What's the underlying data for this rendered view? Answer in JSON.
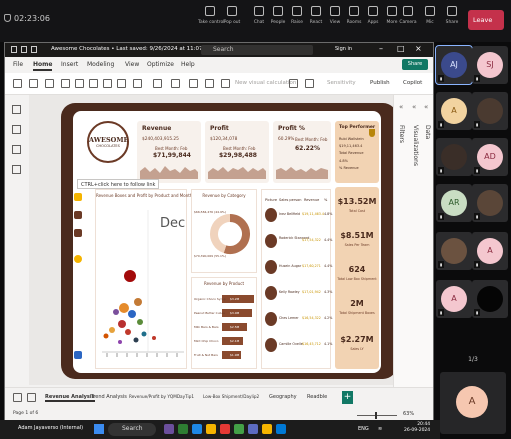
{
  "meeting": {
    "time": "02:23:06",
    "controls": [
      {
        "label": "Take control",
        "icon": "take-control-icon"
      },
      {
        "label": "Pop out",
        "icon": "pop-out-icon"
      },
      {
        "label": "Chat",
        "icon": "chat-icon"
      },
      {
        "label": "People",
        "icon": "people-icon"
      },
      {
        "label": "Raise",
        "icon": "raise-hand-icon"
      },
      {
        "label": "React",
        "icon": "react-icon"
      },
      {
        "label": "View",
        "icon": "view-icon"
      },
      {
        "label": "Rooms",
        "icon": "rooms-icon"
      },
      {
        "label": "Apps",
        "icon": "apps-icon"
      },
      {
        "label": "More",
        "icon": "more-icon"
      },
      {
        "label": "Camera",
        "icon": "camera-icon"
      },
      {
        "label": "Mic",
        "icon": "mic-icon"
      },
      {
        "label": "Share",
        "icon": "share-icon"
      }
    ],
    "people_count": "30",
    "leave_label": "Leave"
  },
  "pbi": {
    "title": "Awesome Chocolates • Last saved: 9/26/2024 at 11:07 PM",
    "search_placeholder": "Search",
    "signin": "Sign in",
    "menu_tabs": [
      "File",
      "Home",
      "Insert",
      "Modeling",
      "View",
      "Optimize",
      "Help"
    ],
    "active_tab": "Home",
    "share_label": "Share",
    "toolbar": {
      "new_visual_calc": "New visual calculation",
      "sensitivity": "Sensitivity",
      "publish": "Publish",
      "copilot": "Copilot"
    },
    "right_panes": [
      "Visualizations",
      "Filters",
      "Data"
    ],
    "page_tabs": [
      "Revenue Analysis",
      "Trend Analysis",
      "Revenue/Profit by YQMDayTip1",
      "Low-Box Shipment/Daylip2",
      "Geography",
      "Readble"
    ],
    "active_page": "Revenue Analysis",
    "status_page": "Page 1 of 6",
    "zoom": "63%"
  },
  "report": {
    "logo_line1": "AWESOME",
    "logo_line2": "CHOCOLATES",
    "tooltip": "CTRL+click here to follow link",
    "kpis": [
      {
        "title": "Revenue",
        "value": "$240,403,915.25",
        "metric_title": "Best Month: Feb",
        "metric_value": "$71,99,844"
      },
      {
        "title": "Profit",
        "value": "$120,34,078",
        "metric_title": "Best Month: Feb",
        "metric_value": "$29,98,488"
      },
      {
        "title": "Profit %",
        "value": "60.29%",
        "metric_title": "Best Month: Feb",
        "metric_value": "62.22%"
      }
    ],
    "top_performer": {
      "title": "Top Performer",
      "lines": [
        "Rubi Wallstein",
        "$19,11,463.4",
        "Total Revenue",
        "4.8%",
        "% Revenue"
      ]
    },
    "panel_titles": {
      "scatter": "Revenue Boxes and Profit by Product and Month",
      "donut": "Revenue by Category",
      "bars": "Revenue by Product"
    },
    "month_label": "Dec",
    "donut": {
      "outer_label": "$66,584,476 (44.9%)",
      "inner_label": "$70,390,069 (55.1%)",
      "segments": [
        {
          "value": 55.1,
          "color": "#b07050"
        },
        {
          "value": 44.9,
          "color": "#f0d3bd"
        }
      ]
    },
    "bars": [
      {
        "name": "Organic Choco Syrup",
        "value": 3.2
      },
      {
        "name": "Peanut Butter Cubes",
        "value": 3.0
      },
      {
        "name": "Milk Bars & Bars",
        "value": 2.5
      },
      {
        "name": "Mint Chip Choco",
        "value": 2.1
      },
      {
        "name": "Fruit & Nut Bars",
        "value": 1.9
      }
    ],
    "bar_labels": [
      "$3.2M",
      "$3.0M",
      "$2.5M",
      "$2.1M",
      "$1.9M"
    ],
    "table_headers": [
      "Picture",
      "Sales person",
      "Revenue",
      "%"
    ],
    "table_rows": [
      {
        "name": "Inez Bellfield",
        "revenue": "$19,11,463.4",
        "pct": "4.8%"
      },
      {
        "name": "Roderick Stannard",
        "revenue": "$17,54,322",
        "pct": "4.4%"
      },
      {
        "name": "Husein Augar",
        "revenue": "$17,60,271",
        "pct": "4.4%"
      },
      {
        "name": "Kelly Rowley",
        "revenue": "$17,01,942",
        "pct": "4.3%"
      },
      {
        "name": "Ches Lemer",
        "revenue": "$16,54,322",
        "pct": "4.2%"
      },
      {
        "name": "Camille Ovelle",
        "revenue": "$16,45,712",
        "pct": "4.1%"
      }
    ],
    "stats": [
      {
        "value": "$13.52M",
        "label": "Total Cost"
      },
      {
        "value": "$8.51M",
        "label": "Sales Per Team"
      },
      {
        "value": "624",
        "label": "Total Low Box Shipment"
      },
      {
        "value": "2M",
        "label": "Total Shipment Boxes"
      },
      {
        "value": "$2.27M",
        "label": "Sales LY"
      }
    ]
  },
  "participants": [
    {
      "initials": "AJ",
      "color": "#3b4a8c",
      "text": "#dbe4ff"
    },
    {
      "initials": "SJ",
      "color": "#f4c7cf",
      "text": "#8a2a3f"
    },
    {
      "initials": "A",
      "color": "#f2d3a0",
      "text": "#8a5a12"
    },
    {
      "initials": "",
      "color": "#4a3a30",
      "text": "#fff"
    },
    {
      "initials": "",
      "color": "#3a2e28",
      "text": "#fff"
    },
    {
      "initials": "AD",
      "color": "#f4c7cf",
      "text": "#8a2a3f"
    },
    {
      "initials": "AR",
      "color": "#c9ddc3",
      "text": "#2c5a2a"
    },
    {
      "initials": "",
      "color": "#5a4638",
      "text": "#fff"
    },
    {
      "initials": "",
      "color": "#6b5240",
      "text": "#fff"
    },
    {
      "initials": "A",
      "color": "#f4c7cf",
      "text": "#8a2a3f"
    },
    {
      "initials": "A",
      "color": "#f4c7cf",
      "text": "#8a2a3f"
    },
    {
      "initials": "",
      "color": "#050505",
      "text": "#fff"
    }
  ],
  "pager": "1/3",
  "self_initial": "A",
  "taskbar": {
    "user": "Adam Jayaverso (Internal)",
    "search": "Search",
    "clock_time": "20:44",
    "clock_date": "26-09-2024",
    "lang": "ENG",
    "lang2": "IN"
  }
}
